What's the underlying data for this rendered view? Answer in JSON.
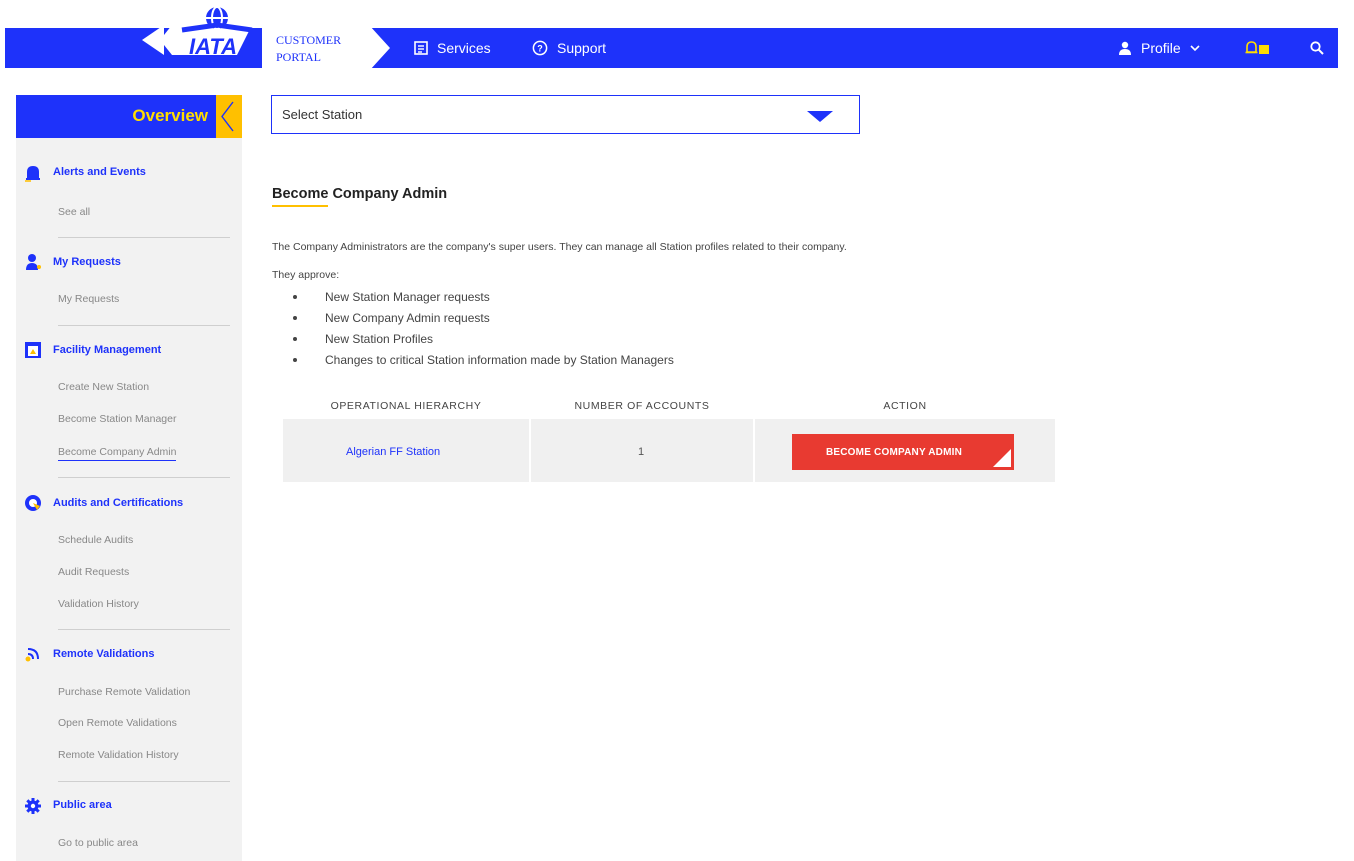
{
  "header": {
    "logo_text": "IATA",
    "portal_line1": "CUSTOMER",
    "portal_line2": "PORTAL",
    "services_label": "Services",
    "support_label": "Support",
    "profile_label": "Profile"
  },
  "sidebar": {
    "overview_label": "Overview",
    "sections": [
      {
        "title": "Alerts and Events",
        "links": [
          "See all"
        ]
      },
      {
        "title": "My Requests",
        "links": [
          "My Requests"
        ]
      },
      {
        "title": "Facility Management",
        "links": [
          "Create New Station",
          "Become Station Manager",
          "Become Company Admin"
        ]
      },
      {
        "title": "Audits and Certifications",
        "links": [
          "Schedule Audits",
          "Audit Requests",
          "Validation History"
        ]
      },
      {
        "title": "Remote Validations",
        "links": [
          "Purchase Remote Validation",
          "Open Remote Validations",
          "Remote Validation History"
        ]
      },
      {
        "title": "Public area",
        "links": [
          "Go to public area"
        ]
      }
    ]
  },
  "main": {
    "station_select_value": "Select Station",
    "title": "Become Company Admin",
    "intro": "The Company Administrators are the company's super users. They can manage all Station profiles related to their company.",
    "approve_label": "They approve:",
    "bullets": [
      "New Station Manager requests",
      "New Company Admin requests",
      "New Station Profiles",
      "Changes to critical Station information made by Station Managers"
    ],
    "table": {
      "headers": [
        "OPERATIONAL HIERARCHY",
        "NUMBER OF ACCOUNTS",
        "ACTION"
      ],
      "rows": [
        {
          "hierarchy": "Algerian FF Station",
          "accounts": "1",
          "action": "BECOME COMPANY ADMIN"
        }
      ]
    }
  },
  "colors": {
    "brand_blue": "#1e32fa",
    "accent_yellow": "#ffc000",
    "action_red": "#e83a31"
  }
}
